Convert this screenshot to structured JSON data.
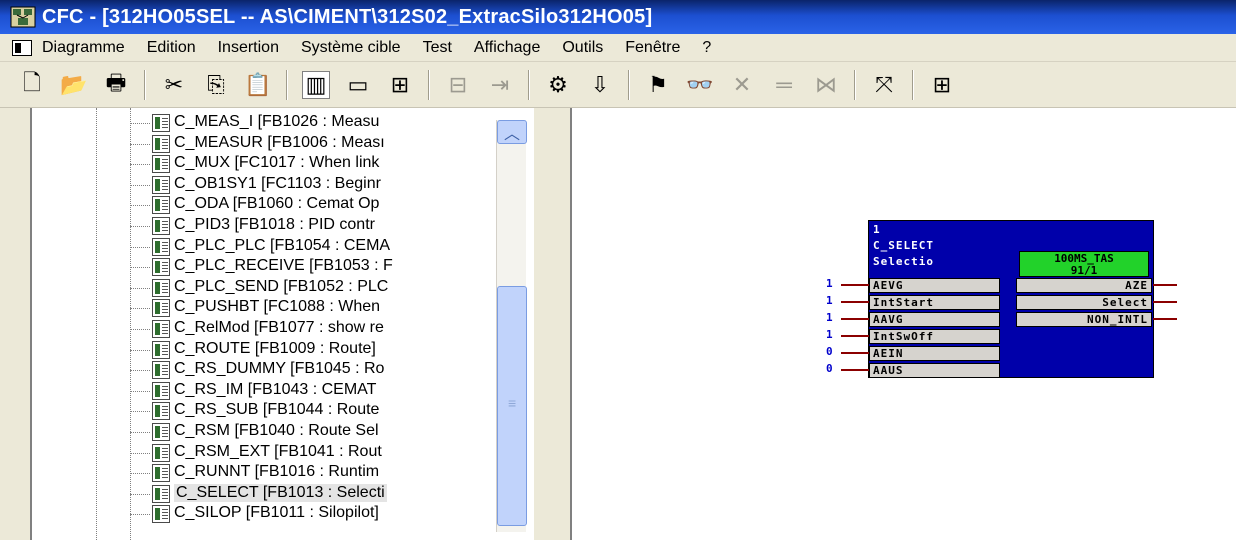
{
  "window": {
    "title": "CFC - [312HO05SEL -- AS\\CIMENT\\312S02_ExtracSilo312HO05]"
  },
  "menu": [
    "Diagramme",
    "Edition",
    "Insertion",
    "Système cible",
    "Test",
    "Affichage",
    "Outils",
    "Fenêtre",
    "?"
  ],
  "toolbar": {
    "buttons": [
      {
        "icon": "new-icon",
        "glyph": "🗋",
        "enabled": true
      },
      {
        "icon": "open-icon",
        "glyph": "📂",
        "enabled": true
      },
      {
        "icon": "print-icon",
        "glyph": "🖶",
        "enabled": true
      },
      {
        "icon": "cut-icon",
        "glyph": "✂",
        "enabled": true
      },
      {
        "icon": "copy-icon",
        "glyph": "⎘",
        "enabled": true
      },
      {
        "icon": "paste-icon",
        "glyph": "📋",
        "enabled": false
      },
      {
        "icon": "catalog-icon",
        "glyph": "▥",
        "enabled": true,
        "pressed": true
      },
      {
        "icon": "sheet-view-icon",
        "glyph": "▭",
        "enabled": true
      },
      {
        "icon": "overview-icon",
        "glyph": "⊞",
        "enabled": true
      },
      {
        "icon": "block-icon",
        "glyph": "⊟",
        "enabled": false
      },
      {
        "icon": "connect-icon",
        "glyph": "⇥",
        "enabled": false
      },
      {
        "icon": "compile-icon",
        "glyph": "⚙",
        "enabled": true
      },
      {
        "icon": "download-icon",
        "glyph": "⇩",
        "enabled": true
      },
      {
        "icon": "test-mode-icon",
        "glyph": "⚑",
        "enabled": true
      },
      {
        "icon": "watch-icon",
        "glyph": "👓",
        "enabled": false
      },
      {
        "icon": "watch-off-icon",
        "glyph": "✕",
        "enabled": false
      },
      {
        "icon": "line-icon",
        "glyph": "═",
        "enabled": false
      },
      {
        "icon": "trend-icon",
        "glyph": "⋈",
        "enabled": false
      },
      {
        "icon": "split-icon",
        "glyph": "⤧",
        "enabled": true
      },
      {
        "icon": "grid-icon",
        "glyph": "⊞",
        "enabled": true
      }
    ]
  },
  "tree": {
    "items": [
      "C_MEAS_I [FB1026 : Measu",
      "C_MEASUR [FB1006 : Meası",
      "C_MUX [FC1017 : When link",
      "C_OB1SY1 [FC1103 : Beginr",
      "C_ODA [FB1060 : Cemat Op",
      "C_PID3 [FB1018 : PID contr",
      "C_PLC_PLC [FB1054 : CEMA",
      "C_PLC_RECEIVE [FB1053 : F",
      "C_PLC_SEND [FB1052 : PLC",
      "C_PUSHBT [FC1088 : When",
      "C_RelMod [FB1077 : show re",
      "C_ROUTE [FB1009 : Route]",
      "C_RS_DUMMY [FB1045 : Ro",
      "C_RS_IM [FB1043 : CEMAT",
      "C_RS_SUB [FB1044 : Route",
      "C_RSM [FB1040 : Route Sel",
      "C_RSM_EXT [FB1041 : Rout",
      "C_RUNNT [FB1016 : Runtim",
      "C_SELECT [FB1013 : Selecti",
      "C_SILOP [FB1011 : Silopilot]"
    ],
    "selected_index": 18
  },
  "block": {
    "number": "1",
    "name": "C_SELECT",
    "comment": "Selectio",
    "runtime_task": "100MS_TAS",
    "runtime_seq": "91/1",
    "inputs": [
      {
        "name": "AEVG",
        "value": "1"
      },
      {
        "name": "IntStart",
        "value": "1"
      },
      {
        "name": "AAVG",
        "value": "1"
      },
      {
        "name": "IntSwOff",
        "value": "1"
      },
      {
        "name": "AEIN",
        "value": "0"
      },
      {
        "name": "AAUS",
        "value": "0"
      }
    ],
    "outputs": [
      "AZE",
      "Select",
      "NON_INTL"
    ]
  },
  "colors": {
    "block_bg": "#0000aa",
    "runtime_bg": "#22d22a",
    "wire": "#8b0000",
    "pin_value": "#0000cc"
  }
}
